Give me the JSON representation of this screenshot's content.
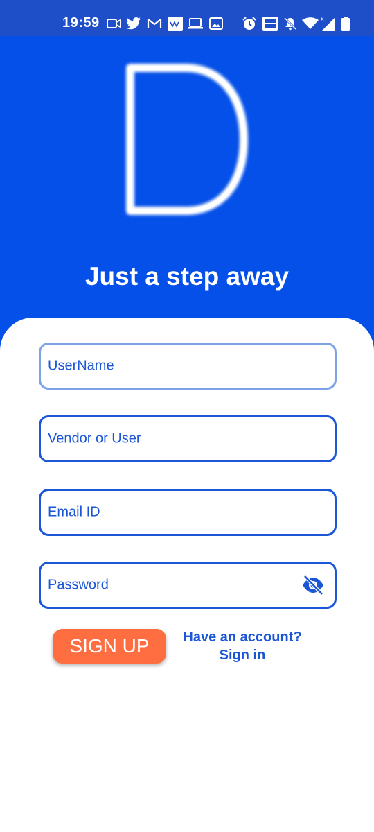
{
  "status_bar": {
    "time": "19:59"
  },
  "hero": {
    "title": "Just a step away"
  },
  "form": {
    "fields": [
      {
        "label": "UserName"
      },
      {
        "label": "Vendor or User"
      },
      {
        "label": "Email ID"
      },
      {
        "label": "Password"
      }
    ],
    "signup_label": "SIGN UP",
    "account_question": "Have an account?",
    "signin_label": "Sign in"
  },
  "colors": {
    "status_bar": "#1F4FC8",
    "hero": "#0450E8",
    "accent": "#1A56D6",
    "signup": "#FF6E40"
  }
}
